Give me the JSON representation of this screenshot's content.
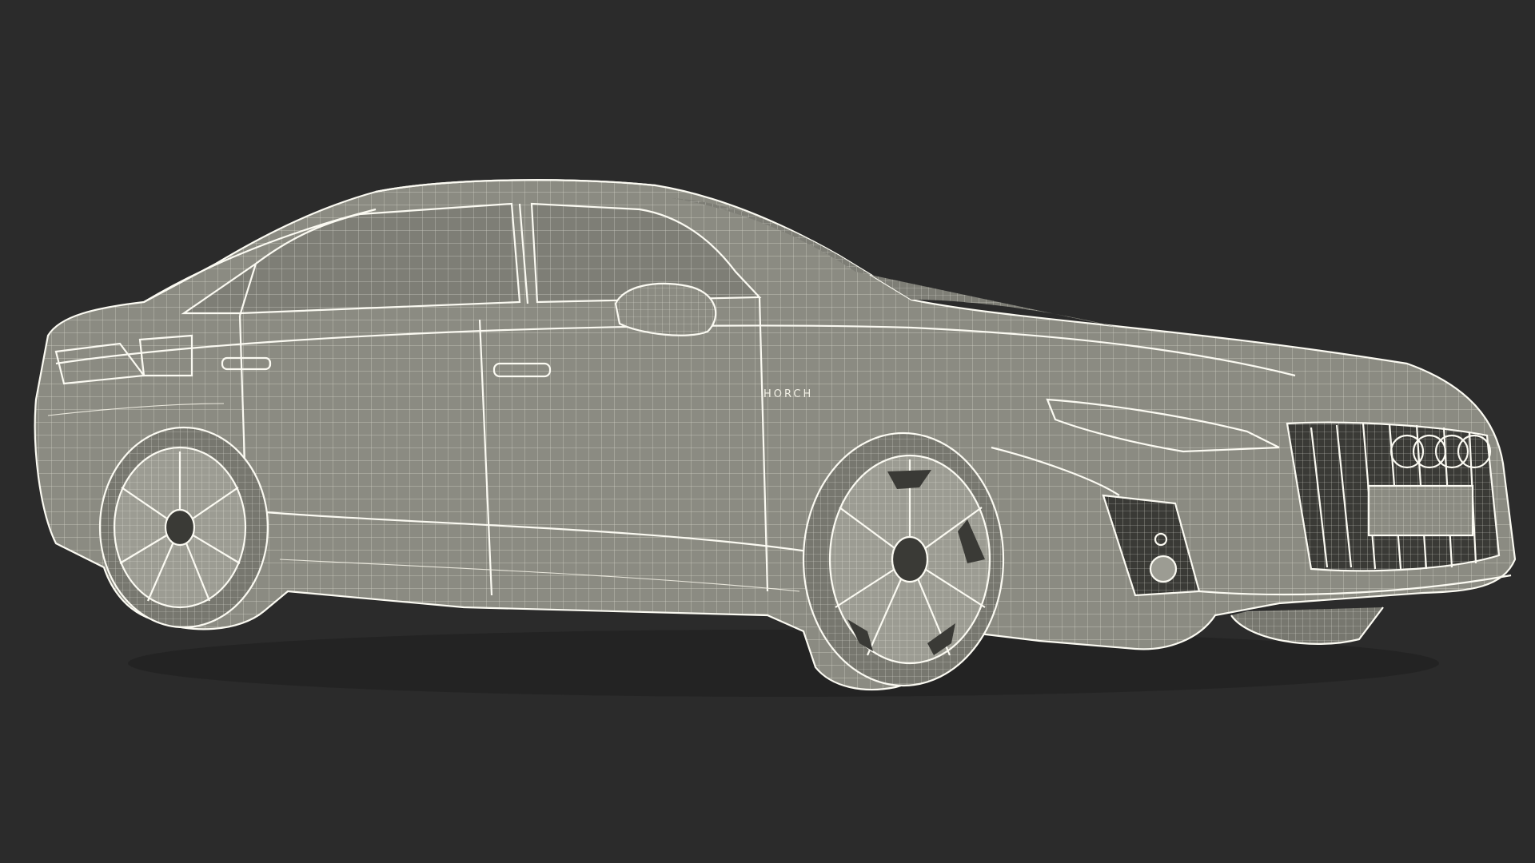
{
  "scene": {
    "background_color": "#2b2b2b",
    "wire_color": "#f3f1e6",
    "surface_color": "#8b8b82",
    "badge_text": "HORCH"
  }
}
